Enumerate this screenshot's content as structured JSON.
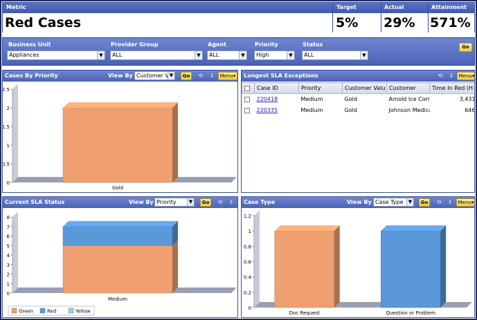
{
  "kpi": {
    "headers": {
      "metric": "Metric",
      "target": "Target",
      "actual": "Actual",
      "attainment": "Attainment"
    },
    "values": {
      "metric": "Red Cases",
      "target": "5%",
      "actual": "29%",
      "attainment": "571%"
    }
  },
  "filters": {
    "business_unit": {
      "label": "Business Unit",
      "value": "Appliances"
    },
    "provider_group": {
      "label": "Provider Group",
      "value": "ALL"
    },
    "agent": {
      "label": "Agent",
      "value": "ALL"
    },
    "priority": {
      "label": "Priority",
      "value": "High"
    },
    "status": {
      "label": "Status",
      "value": "ALL"
    },
    "go_label": "Go"
  },
  "panels": {
    "cases_by_priority": {
      "title": "Cases By Priority",
      "view_by_label": "View By",
      "view_by_value": "Customer V",
      "go_label": "Go",
      "menu_label": "Menu"
    },
    "sla_exceptions": {
      "title": "Longest SLA Exceptions",
      "menu_label": "Menu",
      "columns": [
        "Case ID",
        "Priority",
        "Customer Valu",
        "Customer",
        "Time In Red (H"
      ],
      "rows": [
        {
          "case_id": "220418",
          "priority": "Medium",
          "customer_value": "Gold",
          "customer": "Arnold Ice Corr",
          "time_in_red": "3,431"
        },
        {
          "case_id": "220335",
          "priority": "Medium",
          "customer_value": "Gold",
          "customer": "Johnson Medica",
          "time_in_red": "646"
        }
      ]
    },
    "current_sla_status": {
      "title": "Current SLA Status",
      "view_by_label": "View By",
      "view_by_value": "Priority",
      "go_label": "Go",
      "menu_label": "Menu"
    },
    "case_type": {
      "title": "Case Type",
      "view_by_label": "View By",
      "view_by_value": "Case Type",
      "go_label": "Go",
      "menu_label": "Menu"
    }
  },
  "colors": {
    "orange": "#f0a070",
    "orange_side": "#c86e3e",
    "blue": "#5a98d8",
    "blue_side": "#3a6ea8",
    "light_blue": "#9ad0e0",
    "gray_axis": "#8e95a8"
  },
  "chart_data": [
    {
      "type": "bar",
      "categories": [
        "Gold"
      ],
      "values": [
        2
      ],
      "ylim": [
        0,
        2.5
      ],
      "yticks": [
        "0",
        "0.5",
        "1",
        "1.5",
        "2",
        "2.5"
      ]
    },
    {
      "type": "bar",
      "stacked": true,
      "categories": [
        "Medium"
      ],
      "series": [
        {
          "name": "Green",
          "values": [
            5
          ],
          "color": "#f0a070"
        },
        {
          "name": "Red",
          "values": [
            2
          ],
          "color": "#5a98d8"
        },
        {
          "name": "Yellow",
          "values": [
            0
          ],
          "color": "#9ad0e0"
        }
      ],
      "ylim": [
        0,
        8
      ],
      "yticks": [
        "0",
        "1",
        "2",
        "3",
        "4",
        "5",
        "6",
        "7",
        "8"
      ]
    },
    {
      "type": "bar",
      "categories": [
        "Doc Request",
        "Question or Problem"
      ],
      "values": [
        1,
        1
      ],
      "colors": [
        "#f0a070",
        "#5a98d8"
      ],
      "ylim": [
        0,
        1.2
      ],
      "yticks": [
        "0",
        "0.2",
        "0.4",
        "0.6",
        "0.8",
        "1",
        "1.2"
      ]
    }
  ]
}
